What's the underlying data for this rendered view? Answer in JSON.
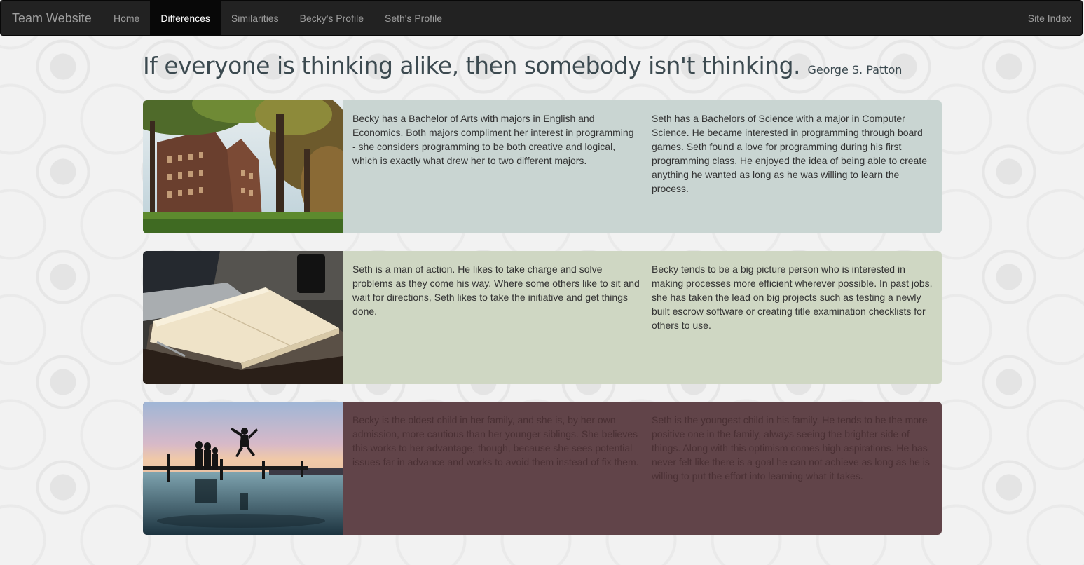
{
  "navbar": {
    "brand": "Team Website",
    "links": [
      {
        "label": "Home",
        "active": false
      },
      {
        "label": "Differences",
        "active": true
      },
      {
        "label": "Similarities",
        "active": false
      },
      {
        "label": "Becky's Profile",
        "active": false
      },
      {
        "label": "Seth's Profile",
        "active": false
      }
    ],
    "right_link": "Site Index"
  },
  "quote": {
    "text": "If everyone is thinking alike, then somebody isn't thinking.",
    "author": "George S. Patton"
  },
  "panels": [
    {
      "background": "#c9d5d2",
      "left_text": "Becky has a Bachelor of Arts with majors in English and Economics. Both majors compliment her interest in programming - she considers programming to be both creative and logical, which is exactly what drew her to two different majors.",
      "right_text": "Seth has a Bachelors of Science with a major in Computer Science. He became interested in programming through board games. Seth found a love for programming during his first programming class. He enjoyed the idea of being able to create anything he wanted as long as he was willing to learn the process."
    },
    {
      "background": "#cfd7c3",
      "left_text": "Seth is a man of action. He likes to take charge and solve problems as they come his way. Where some others like to sit and wait for directions, Seth likes to take the initiative and get things done.",
      "right_text": "Becky tends to be a big picture person who is interested in making processes more efficient wherever possible. In past jobs, she has taken the lead on big projects such as testing a newly built escrow software or creating title examination checklists for others to use."
    },
    {
      "background": "#614449",
      "left_text": "Becky is the oldest child in her family, and she is, by her own admission, more cautious than her younger siblings. She believes this works to her advantage, though, because she sees potential issues far in advance and works to avoid them instead of fix them.",
      "right_text": "Seth is the youngest child in his family. He tends to be the more positive one in the family, always seeing the brighter side of things. Along with this optimism comes high aspirations. He has never felt like there is a goal he can not achieve as long as he is willing to put the effort into learning what it takes."
    }
  ]
}
